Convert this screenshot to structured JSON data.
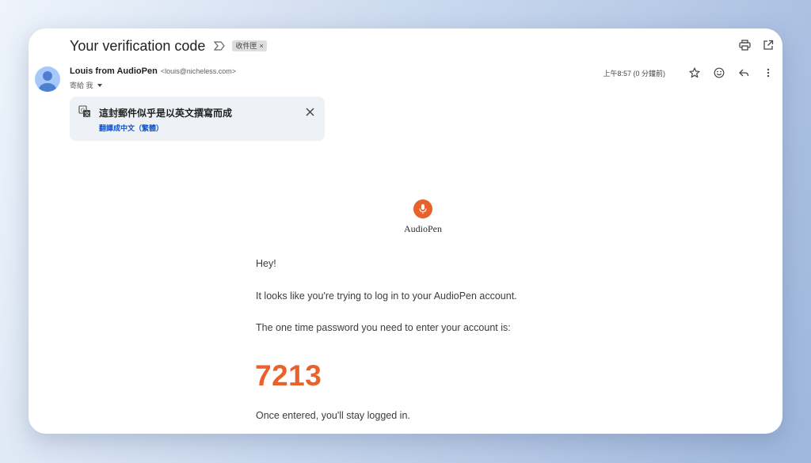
{
  "email": {
    "subject": "Your verification code",
    "label": "收件匣",
    "label_remove": "×",
    "sender_name": "Louis from AudioPen",
    "sender_email": "<louis@nicheless.com>",
    "to_text": "寄給 我",
    "timestamp": "上午8:57 (0 分鐘前)"
  },
  "translate": {
    "title": "這封郵件似乎是以英文撰寫而成",
    "link": "翻譯成中文（繁體）"
  },
  "body": {
    "brand": "AudioPen",
    "greeting": "Hey!",
    "line1": "It looks like you're trying to log in to your AudioPen account.",
    "line2": "The one time password you need to enter your account is:",
    "code": "7213",
    "line3": "Once entered, you'll stay logged in."
  },
  "colors": {
    "accent": "#e8622c",
    "link": "#0b57d0",
    "avatar": "#a8c7fa"
  },
  "icons": {
    "important": "important-marker-icon",
    "print": "print-icon",
    "open_new": "open-in-new-icon",
    "star": "star-icon",
    "emoji": "emoji-icon",
    "reply": "reply-icon",
    "more": "more-vert-icon",
    "translate": "translate-icon",
    "close": "close-icon",
    "mic": "microphone-icon"
  }
}
